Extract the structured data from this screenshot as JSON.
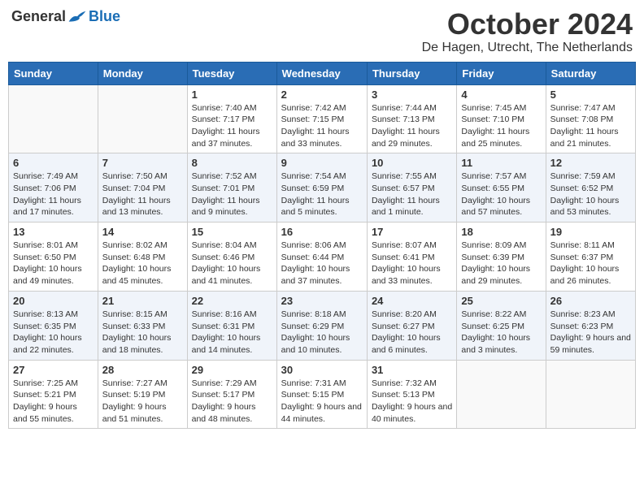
{
  "header": {
    "logo_general": "General",
    "logo_blue": "Blue",
    "month_title": "October 2024",
    "location": "De Hagen, Utrecht, The Netherlands"
  },
  "days_of_week": [
    "Sunday",
    "Monday",
    "Tuesday",
    "Wednesday",
    "Thursday",
    "Friday",
    "Saturday"
  ],
  "weeks": [
    [
      {
        "day": "",
        "info": ""
      },
      {
        "day": "",
        "info": ""
      },
      {
        "day": "1",
        "info": "Sunrise: 7:40 AM\nSunset: 7:17 PM\nDaylight: 11 hours and 37 minutes."
      },
      {
        "day": "2",
        "info": "Sunrise: 7:42 AM\nSunset: 7:15 PM\nDaylight: 11 hours and 33 minutes."
      },
      {
        "day": "3",
        "info": "Sunrise: 7:44 AM\nSunset: 7:13 PM\nDaylight: 11 hours and 29 minutes."
      },
      {
        "day": "4",
        "info": "Sunrise: 7:45 AM\nSunset: 7:10 PM\nDaylight: 11 hours and 25 minutes."
      },
      {
        "day": "5",
        "info": "Sunrise: 7:47 AM\nSunset: 7:08 PM\nDaylight: 11 hours and 21 minutes."
      }
    ],
    [
      {
        "day": "6",
        "info": "Sunrise: 7:49 AM\nSunset: 7:06 PM\nDaylight: 11 hours and 17 minutes."
      },
      {
        "day": "7",
        "info": "Sunrise: 7:50 AM\nSunset: 7:04 PM\nDaylight: 11 hours and 13 minutes."
      },
      {
        "day": "8",
        "info": "Sunrise: 7:52 AM\nSunset: 7:01 PM\nDaylight: 11 hours and 9 minutes."
      },
      {
        "day": "9",
        "info": "Sunrise: 7:54 AM\nSunset: 6:59 PM\nDaylight: 11 hours and 5 minutes."
      },
      {
        "day": "10",
        "info": "Sunrise: 7:55 AM\nSunset: 6:57 PM\nDaylight: 11 hours and 1 minute."
      },
      {
        "day": "11",
        "info": "Sunrise: 7:57 AM\nSunset: 6:55 PM\nDaylight: 10 hours and 57 minutes."
      },
      {
        "day": "12",
        "info": "Sunrise: 7:59 AM\nSunset: 6:52 PM\nDaylight: 10 hours and 53 minutes."
      }
    ],
    [
      {
        "day": "13",
        "info": "Sunrise: 8:01 AM\nSunset: 6:50 PM\nDaylight: 10 hours and 49 minutes."
      },
      {
        "day": "14",
        "info": "Sunrise: 8:02 AM\nSunset: 6:48 PM\nDaylight: 10 hours and 45 minutes."
      },
      {
        "day": "15",
        "info": "Sunrise: 8:04 AM\nSunset: 6:46 PM\nDaylight: 10 hours and 41 minutes."
      },
      {
        "day": "16",
        "info": "Sunrise: 8:06 AM\nSunset: 6:44 PM\nDaylight: 10 hours and 37 minutes."
      },
      {
        "day": "17",
        "info": "Sunrise: 8:07 AM\nSunset: 6:41 PM\nDaylight: 10 hours and 33 minutes."
      },
      {
        "day": "18",
        "info": "Sunrise: 8:09 AM\nSunset: 6:39 PM\nDaylight: 10 hours and 29 minutes."
      },
      {
        "day": "19",
        "info": "Sunrise: 8:11 AM\nSunset: 6:37 PM\nDaylight: 10 hours and 26 minutes."
      }
    ],
    [
      {
        "day": "20",
        "info": "Sunrise: 8:13 AM\nSunset: 6:35 PM\nDaylight: 10 hours and 22 minutes."
      },
      {
        "day": "21",
        "info": "Sunrise: 8:15 AM\nSunset: 6:33 PM\nDaylight: 10 hours and 18 minutes."
      },
      {
        "day": "22",
        "info": "Sunrise: 8:16 AM\nSunset: 6:31 PM\nDaylight: 10 hours and 14 minutes."
      },
      {
        "day": "23",
        "info": "Sunrise: 8:18 AM\nSunset: 6:29 PM\nDaylight: 10 hours and 10 minutes."
      },
      {
        "day": "24",
        "info": "Sunrise: 8:20 AM\nSunset: 6:27 PM\nDaylight: 10 hours and 6 minutes."
      },
      {
        "day": "25",
        "info": "Sunrise: 8:22 AM\nSunset: 6:25 PM\nDaylight: 10 hours and 3 minutes."
      },
      {
        "day": "26",
        "info": "Sunrise: 8:23 AM\nSunset: 6:23 PM\nDaylight: 9 hours and 59 minutes."
      }
    ],
    [
      {
        "day": "27",
        "info": "Sunrise: 7:25 AM\nSunset: 5:21 PM\nDaylight: 9 hours and 55 minutes."
      },
      {
        "day": "28",
        "info": "Sunrise: 7:27 AM\nSunset: 5:19 PM\nDaylight: 9 hours and 51 minutes."
      },
      {
        "day": "29",
        "info": "Sunrise: 7:29 AM\nSunset: 5:17 PM\nDaylight: 9 hours and 48 minutes."
      },
      {
        "day": "30",
        "info": "Sunrise: 7:31 AM\nSunset: 5:15 PM\nDaylight: 9 hours and 44 minutes."
      },
      {
        "day": "31",
        "info": "Sunrise: 7:32 AM\nSunset: 5:13 PM\nDaylight: 9 hours and 40 minutes."
      },
      {
        "day": "",
        "info": ""
      },
      {
        "day": "",
        "info": ""
      }
    ]
  ]
}
